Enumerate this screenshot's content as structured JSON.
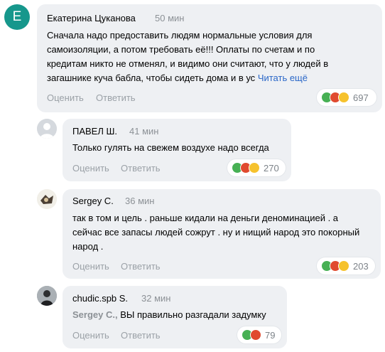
{
  "actions": {
    "rate": "Оценить",
    "reply": "Ответить"
  },
  "colors": {
    "like": "#47b054",
    "dislike": "#e04a2f",
    "laugh": "#f6c22d",
    "link": "#2a67c8",
    "avatar_bg": "#16978c"
  },
  "comments": [
    {
      "avatar_letter": "E",
      "author": "Екатерина Цуканова",
      "time": "50 мин",
      "text": "Сначала надо предоставить людям нормальные условия для самоизоляции, а потом требовать её!!! Оплаты по счетам и по кредитам никто не отменял, и видимо они считают, что у людей в загашнике куча бабла, чтобы сидеть дома и в ус",
      "more": "Читать ещё",
      "reaction_count": "697",
      "reaction_icons": [
        "like-icon",
        "dislike-icon",
        "laugh-icon"
      ]
    },
    {
      "author": "ПАВЕЛ Ш.",
      "time": "41 мин",
      "text": "Только гулять на свежем воздухе надо всегда",
      "reaction_count": "270",
      "reaction_icons": [
        "like-icon",
        "dislike-icon",
        "laugh-icon"
      ]
    },
    {
      "author": "Sergey C.",
      "time": "36 мин",
      "text": "так в том и цель . раньше кидали на деньги деноминацией . а сейчас все запасы людей сожрут . ну и нищий народ это покорный народ .",
      "reaction_count": "203",
      "reaction_icons": [
        "like-icon",
        "dislike-icon",
        "laugh-icon"
      ]
    },
    {
      "author": "chudic.spb S.",
      "time": "32 мин",
      "mention": "Sergey C.,",
      "text": " ВЫ правильно разгадали задумку",
      "reaction_count": "79",
      "reaction_icons": [
        "like-icon",
        "dislike-icon"
      ]
    }
  ]
}
